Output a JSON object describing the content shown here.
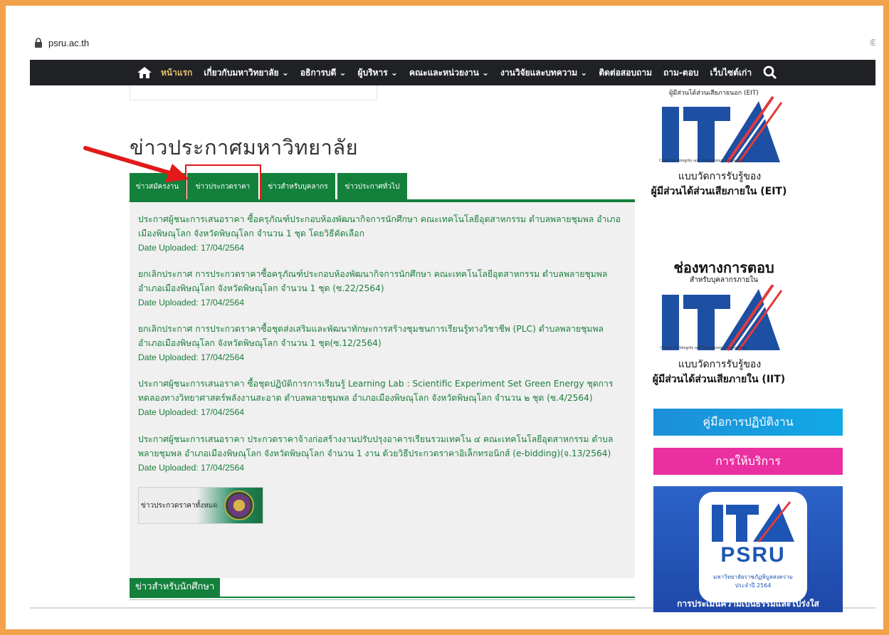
{
  "browser": {
    "url": "psru.ac.th",
    "right_glyph": "©"
  },
  "nav": {
    "items": [
      {
        "label": "หน้าแรก",
        "active": true
      },
      {
        "label": "เกี่ยวกับมหาวิทยาลัย ⌄"
      },
      {
        "label": "อธิการบดี ⌄"
      },
      {
        "label": "ผู้บริหาร ⌄"
      },
      {
        "label": "คณะและหน่วยงาน ⌄"
      },
      {
        "label": "งานวิจัยและบทความ ⌄"
      },
      {
        "label": "ติดต่อสอบถาม"
      },
      {
        "label": "ถาม-ตอบ"
      },
      {
        "label": "เว็บไซต์เก่า"
      }
    ],
    "icons": {
      "home": "home-icon",
      "search": "search-icon"
    },
    "colors": {
      "bar": "#1f2125",
      "text": "#e9c36d"
    }
  },
  "main": {
    "title": "ข่าวประกาศมหาวิทยาลัย",
    "tabs": [
      {
        "label": "ข่าวสมัครงาน"
      },
      {
        "label": "ข่าวประกวดราคา",
        "selected": true
      },
      {
        "label": "ข่าวสำหรับบุคลากร"
      },
      {
        "label": "ข่าวประกาศทั่วไป"
      }
    ],
    "news": [
      {
        "title": "ประกาศผู้ชนะการเสนอราคา ซื้อครุภัณฑ์ประกอบห้องพัฒนากิจการนักศึกษา คณะเทคโนโลยีอุตสาหกรรม ตำบลพลายชุมพล อำเภอเมืองพิษณุโลก จังหวัดพิษณุโลก จำนวน 1 ชุด โดยวิธีคัดเลือก",
        "date": "Date Uploaded: 17/04/2564"
      },
      {
        "title": "ยกเลิกประกาศ การประกวดราคาซื้อครุภัณฑ์ประกอบห้องพัฒนากิจการนักศึกษา คณะเทคโนโลยีอุตสาหกรรม ตำบลพลายชุมพล อำเภอเมืองพิษณุโลก จังหวัดพิษณุโลก จำนวน 1 ชุด (ซ.22/2564)",
        "date": "Date Uploaded: 17/04/2564"
      },
      {
        "title": "ยกเลิกประกาศ การประกวดราคาซื้อชุดส่งเสริมและพัฒนาทักษะการสร้างชุมชนการเรียนรู้ทางวิชาชีพ (PLC) ตำบลพลายชุมพล อำเภอเมืองพิษณุโลก จังหวัดพิษณุโลก จำนวน 1 ชุด(ซ.12/2564)",
        "date": "Date Uploaded: 17/04/2564"
      },
      {
        "title": "ประกาศผู้ชนะการเสนอราคา ซื้อชุดปฏิบัติการการเรียนรู้ Learning Lab : Scientific Experiment Set Green Energy ชุดการทดลองทางวิทยาศาสตร์พลังงานสะอาด ตำบลพลายชุมพล อำเภอเมืองพิษณุโลก จังหวัดพิษณุโลก จำนวน ๒ ชุด (ซ.4/2564)",
        "date": "Date Uploaded: 17/04/2564"
      },
      {
        "title": "ประกาศผู้ชนะการเสนอราคา ประกวดราคาจ้างก่อสร้างงานปรับปรุงอาคารเรียนรวมเทคโน ๔ คณะเทคโนโลยีอุตสาหกรรม ตำบลพลายชุมพล อำเภอเมืองพิษณุโลก จังหวัดพิษณุโลก จำนวน 1 งาน ด้วยวิธีประกวดราคาอิเล็กทรอนิกส์ (e-bidding)(จ.13/2564)",
        "date": "Date Uploaded: 17/04/2564"
      }
    ],
    "all_button": "ข่าวประกวดราคาทั้งหมด",
    "students_header": "ข่าวสำหรับนักศึกษา"
  },
  "sidebar": {
    "eit": {
      "top_caption": "ผู้มีส่วนได้ส่วนเสียภายนอก (EIT)",
      "logo_text": "ITA",
      "small_text": "Center for Integrity and Transparency Assessment",
      "line1": "แบบวัดการรับรู้ของ",
      "line2": "ผู้มีส่วนได้ส่วนเสียภายใน (EIT)"
    },
    "iit": {
      "heading": "ช่องทางการตอบ",
      "subheading": "สำหรับบุคลากรภายใน",
      "logo_text": "ITA",
      "small_text": "Center for Integrity and Transparency Assessment",
      "line1": "แบบวัดการรับรู้ของ",
      "line2": "ผู้มีส่วนได้ส่วนเสียภายใน (IIT)"
    },
    "manual_button": "คู่มือการปฏิบัติงาน",
    "service_button": "การให้บริการ",
    "psru": {
      "ita": "ITA",
      "name": "PSRU",
      "sub1": "มหาวิทยาลัยราชภัฏพิบูลสงคราม",
      "sub2": "ประจำปี 2564",
      "bottom": "การประเมินความเป็นธรรมและโปร่งใส"
    },
    "colors": {
      "ita_blue": "#1d4fa3",
      "ita_red": "#e23b3b",
      "manual": "#1d8fd8",
      "service": "#ea2fa0"
    }
  },
  "annotation": {
    "highlight_color": "#e11a1a"
  },
  "theme": {
    "accent_green": "#13803b",
    "link_green": "#1c7e3c",
    "frame_orange": "#f2a24a"
  }
}
